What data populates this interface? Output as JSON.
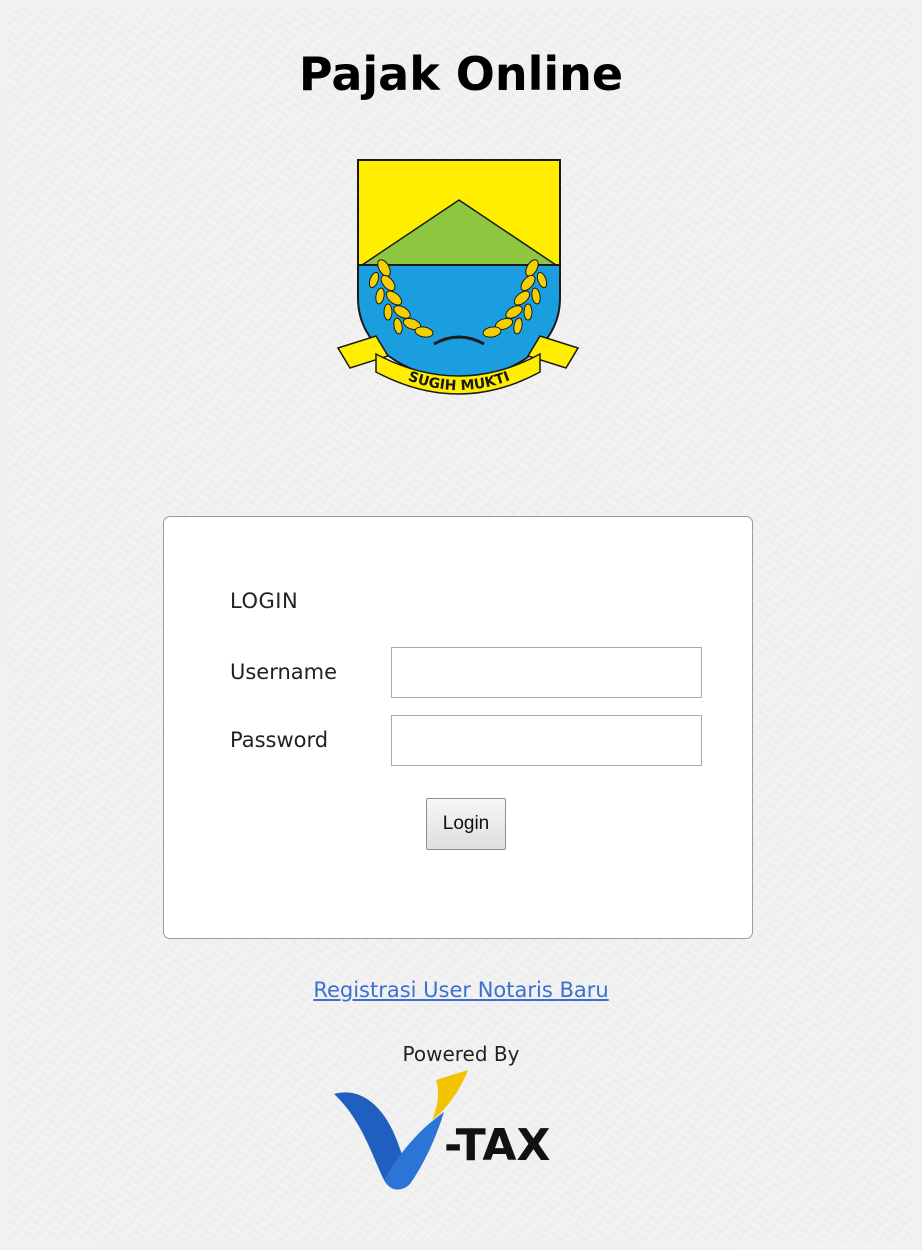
{
  "header": {
    "title": "Pajak Online"
  },
  "emblem": {
    "motto": "SUGIH MUKTI",
    "colors": {
      "shield_yellow": "#ffee00",
      "mountain_green": "#8dc63f",
      "water_blue": "#1a9ee0",
      "rice_gold": "#f5d000",
      "outline": "#1a1a1a"
    }
  },
  "login_form": {
    "heading": "LOGIN",
    "username_label": "Username",
    "username_value": "",
    "password_label": "Password",
    "password_value": "",
    "submit_label": "Login"
  },
  "footer": {
    "register_link": "Registrasi User Notaris Baru",
    "powered_by": "Powered By",
    "vendor_logo": {
      "text": "-TAX",
      "colors": {
        "v_blue": "#1f5fbf",
        "v_yellow": "#f2c400",
        "text": "#111111"
      }
    }
  }
}
